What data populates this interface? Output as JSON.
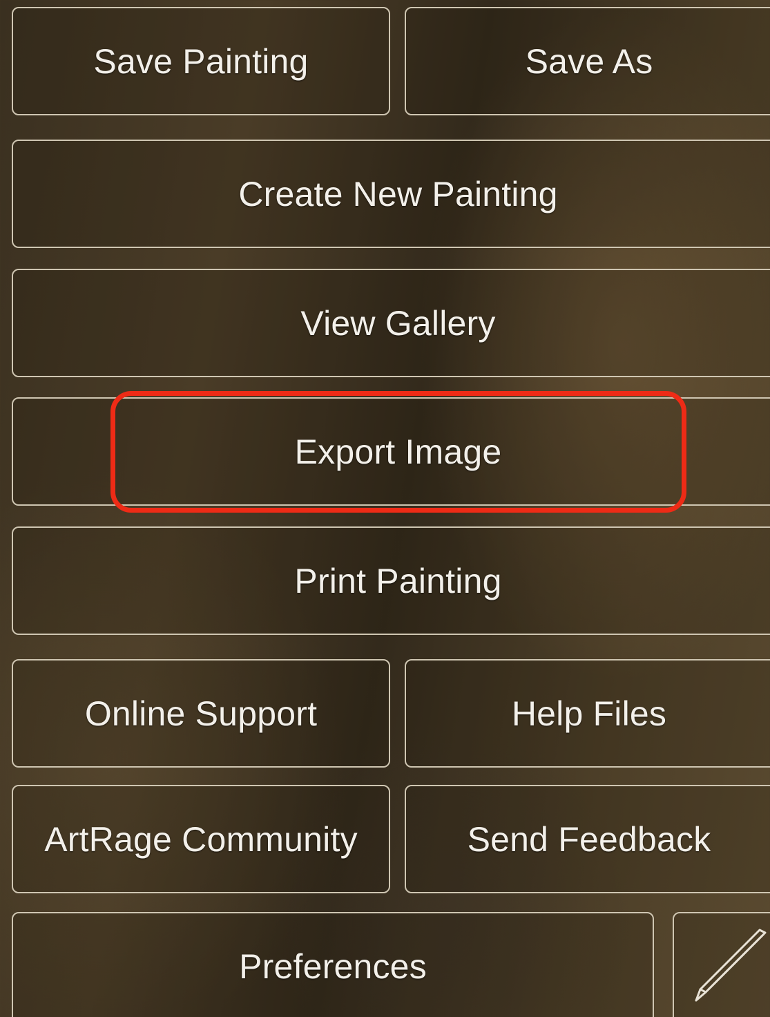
{
  "menu": {
    "save_painting": "Save Painting",
    "save_as": "Save As",
    "create_new_painting": "Create New Painting",
    "view_gallery": "View Gallery",
    "export_image": "Export Image",
    "print_painting": "Print Painting",
    "online_support": "Online Support",
    "help_files": "Help Files",
    "artrage_community": "ArtRage Community",
    "send_feedback": "Send Feedback",
    "preferences": "Preferences"
  },
  "highlight": {
    "target": "export_image",
    "color": "#ee2b16"
  },
  "icons": {
    "pen_button": "pen-icon"
  },
  "colors": {
    "button_border": "#cfc6b2",
    "button_text": "#f3f0ea"
  }
}
